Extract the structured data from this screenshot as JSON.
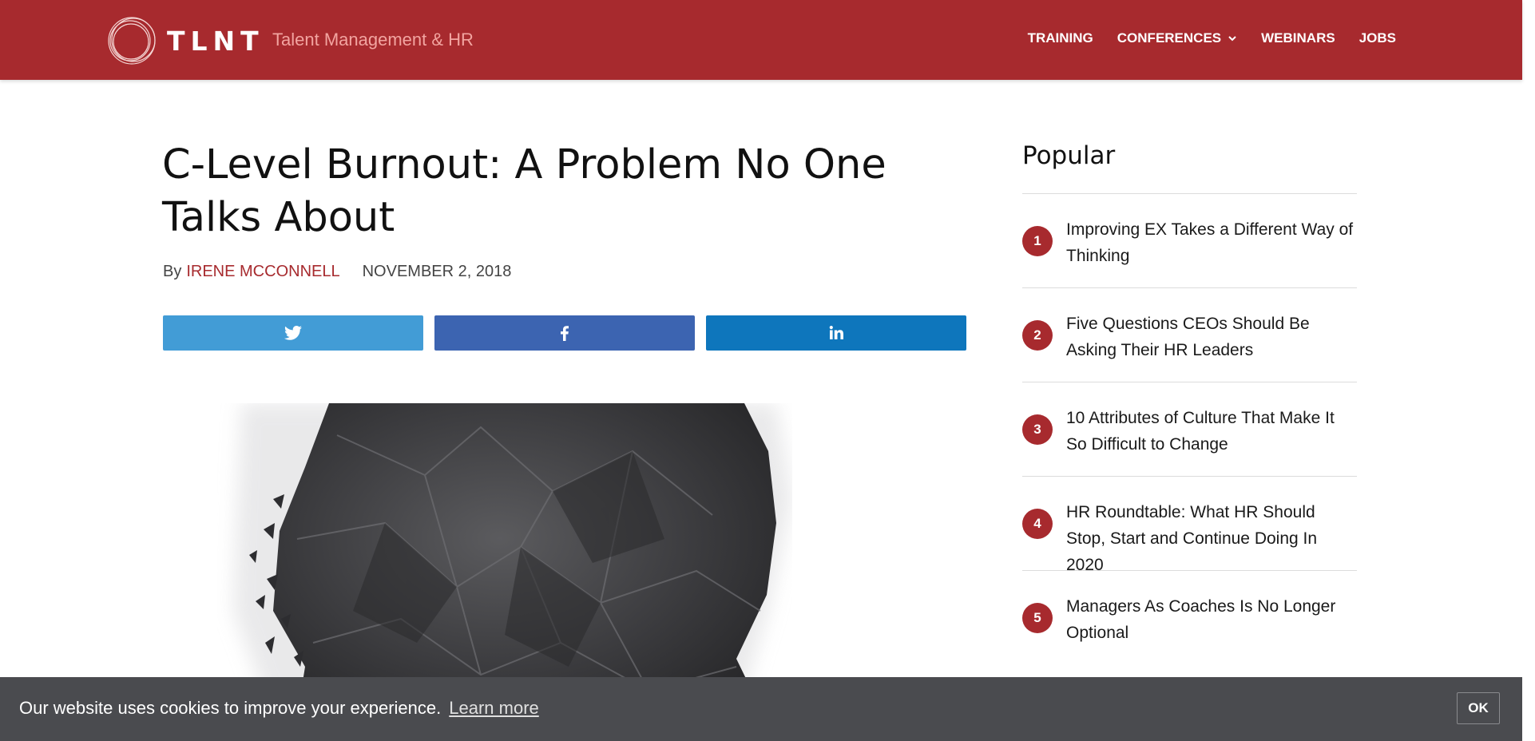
{
  "header": {
    "logo_text": "TLNT",
    "tagline": "Talent Management & HR",
    "nav": [
      {
        "label": "TRAINING",
        "icon": ""
      },
      {
        "label": "CONFERENCES",
        "icon": "chevron-down-icon"
      },
      {
        "label": "WEBINARS",
        "icon": ""
      },
      {
        "label": "JOBS",
        "icon": ""
      }
    ],
    "brand_color": "#a72a2e"
  },
  "article": {
    "title": "C-Level Burnout: A Problem No One Talks About",
    "by_label": "By",
    "author": "IRENE MCCONNELL",
    "date": "NOVEMBER 2, 2018",
    "share_buttons": [
      {
        "network": "twitter",
        "icon": "twitter-icon",
        "color": "#429cd6"
      },
      {
        "network": "facebook",
        "icon": "facebook-icon",
        "color": "#3c64b1"
      },
      {
        "network": "linkedin",
        "icon": "linkedin-icon",
        "color": "#0e76bc"
      }
    ]
  },
  "sidebar": {
    "title": "Popular",
    "items": [
      {
        "num": "1",
        "label": "Improving EX Takes a Different Way of Thinking"
      },
      {
        "num": "2",
        "label": "Five Questions CEOs Should Be Asking Their HR Leaders"
      },
      {
        "num": "3",
        "label": "10 Attributes of Culture That Make It So Difficult to Change"
      },
      {
        "num": "4",
        "label": "HR Roundtable: What HR Should Stop, Start and Continue Doing In 2020"
      },
      {
        "num": "5",
        "label": "Managers As Coaches Is No Longer Optional"
      }
    ]
  },
  "cookie": {
    "message": "Our website uses cookies to improve your experience.",
    "link_label": "Learn more",
    "ok_label": "OK"
  }
}
